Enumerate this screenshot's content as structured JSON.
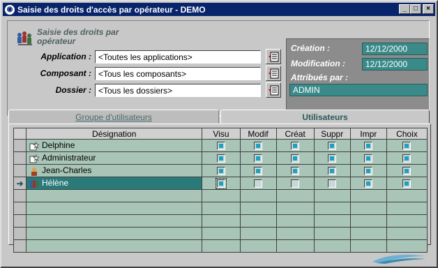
{
  "window": {
    "title": "Saisie des droits d'accès par opérateur - DEMO",
    "buttons": [
      "_",
      "□",
      "×"
    ]
  },
  "header": {
    "logo_text": "Saisie des droits par opérateur"
  },
  "form": {
    "application": {
      "label": "Application :",
      "value": "<Toutes les applications>"
    },
    "composant": {
      "label": "Composant :",
      "value": "<Tous les composants>"
    },
    "dossier": {
      "label": "Dossier :",
      "value": "<Tous les dossiers>"
    }
  },
  "info": {
    "creation": {
      "label": "Création :",
      "value": "12/12/2000"
    },
    "modification": {
      "label": "Modification :",
      "value": "12/12/2000"
    },
    "attribues": {
      "label": "Attribués par :",
      "value": "ADMIN"
    }
  },
  "tabs": [
    {
      "label": "Groupe d'utilisateurs",
      "active": false
    },
    {
      "label": "Utilisateurs",
      "active": true
    }
  ],
  "grid": {
    "columns": [
      "Désignation",
      "Visu",
      "Modif",
      "Créat",
      "Suppr",
      "Impr",
      "Choix"
    ],
    "rows": [
      {
        "name": "Delphine",
        "icon": "user-spark-icon",
        "rights": [
          true,
          true,
          true,
          true,
          true,
          true
        ],
        "current": false
      },
      {
        "name": "Administrateur",
        "icon": "user-spark-icon",
        "rights": [
          true,
          true,
          true,
          true,
          true,
          true
        ],
        "current": false
      },
      {
        "name": "Jean-Charles",
        "icon": "person-icon",
        "rights": [
          true,
          true,
          true,
          true,
          true,
          true
        ],
        "current": false
      },
      {
        "name": "Hélène",
        "icon": "group-icon",
        "rights": [
          true,
          false,
          false,
          false,
          true,
          true
        ],
        "current": true
      }
    ],
    "empty_rows": 5,
    "row_marker": "➜"
  },
  "colors": {
    "title_bar": "#08246b",
    "accent": "#2a7a7a",
    "grid_bg": "#a9c5b8",
    "info_bg": "#8c8c8c"
  }
}
